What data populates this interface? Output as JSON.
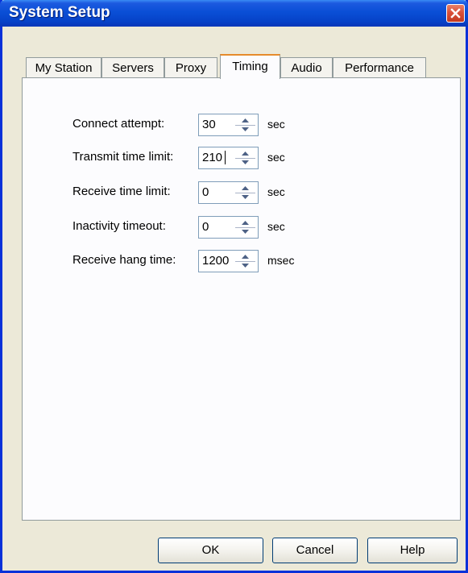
{
  "window": {
    "title": "System Setup"
  },
  "tabs": [
    {
      "label": "My Station",
      "active": false
    },
    {
      "label": "Servers",
      "active": false
    },
    {
      "label": "Proxy",
      "active": false
    },
    {
      "label": "Timing",
      "active": true
    },
    {
      "label": "Audio",
      "active": false
    },
    {
      "label": "Performance",
      "active": false
    }
  ],
  "timing": [
    {
      "label": "Connect attempt:",
      "value": "30",
      "unit": "sec"
    },
    {
      "label": "Transmit time limit:",
      "value": "210",
      "unit": "sec"
    },
    {
      "label": "Receive time limit:",
      "value": "0",
      "unit": "sec"
    },
    {
      "label": "Inactivity timeout:",
      "value": "0",
      "unit": "sec"
    },
    {
      "label": "Receive hang time:",
      "value": "1200",
      "unit": "msec"
    }
  ],
  "buttons": {
    "ok": "OK",
    "cancel": "Cancel",
    "help": "Help"
  }
}
